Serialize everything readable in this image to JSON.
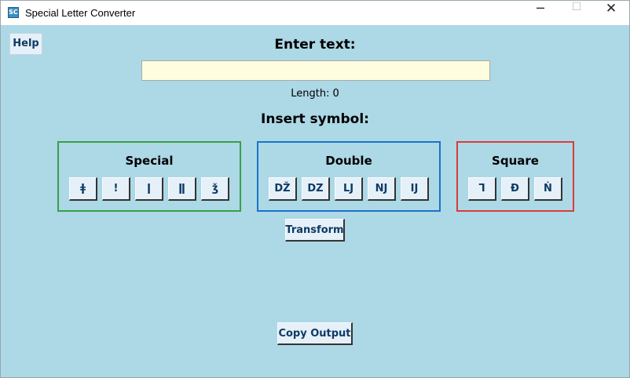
{
  "window": {
    "title": "Special Letter Converter",
    "icon": "app-logo-icon",
    "controls": {
      "minimize": "─",
      "maximize": "☐",
      "close": "✕"
    }
  },
  "help": {
    "label": "Help"
  },
  "input_section": {
    "heading": "Enter text:",
    "value": "",
    "length_label": "Length:",
    "length_value": "0"
  },
  "symbols": {
    "heading": "Insert symbol:",
    "groups": [
      {
        "title": "Special",
        "color": "#36a046",
        "symbols": [
          "ǂ",
          "!",
          "ǀ",
          "ǁ",
          "ǯ"
        ]
      },
      {
        "title": "Double",
        "color": "#1a73c8",
        "symbols": [
          "DŽ",
          "DZ",
          "LJ",
          "NJ",
          "IJ"
        ]
      },
      {
        "title": "Square",
        "color": "#d93b3b",
        "symbols": [
          "Ꞁ",
          "Ɖ",
          "Ṅ"
        ]
      }
    ]
  },
  "actions": {
    "transform": "Transform",
    "copy_output": "Copy Output"
  },
  "colors": {
    "background": "#add8e6",
    "input_bg": "#fffde0",
    "button_bg": "#e6f0f8",
    "button_text": "#0d3a64"
  }
}
